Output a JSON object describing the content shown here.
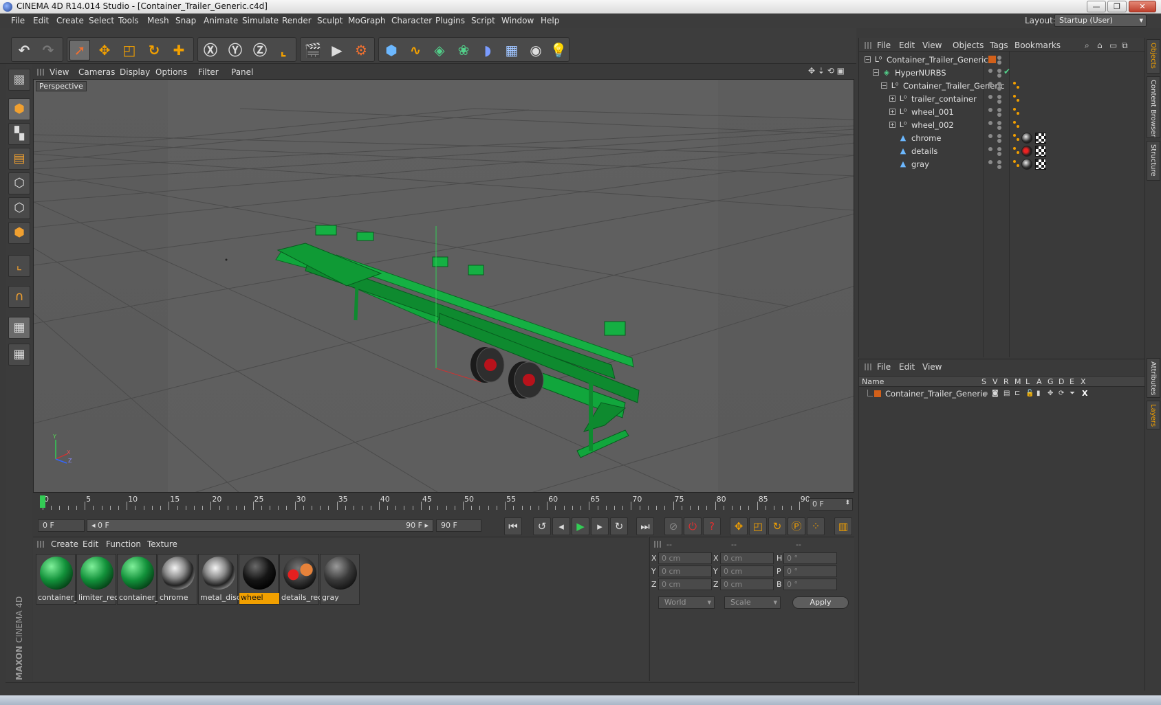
{
  "window": {
    "title": "CINEMA 4D R14.014 Studio - [Container_Trailer_Generic.c4d]",
    "buttons": {
      "minimize": "—",
      "maximize": "❐",
      "close": "✕"
    }
  },
  "menubar": {
    "items": [
      "File",
      "Edit",
      "Create",
      "Select",
      "Tools",
      "Mesh",
      "Snap",
      "Animate",
      "Simulate",
      "Render",
      "Sculpt",
      "MoGraph",
      "Character",
      "Plugins",
      "Script",
      "Window",
      "Help"
    ],
    "layout_label": "Layout:",
    "layout_value": "Startup (User)"
  },
  "viewport": {
    "menu": [
      "View",
      "Cameras",
      "Display",
      "Options",
      "Filter",
      "Panel"
    ],
    "label": "Perspective",
    "axis": {
      "y": "Y",
      "x": "X",
      "z": "Z"
    }
  },
  "timeline": {
    "ticks": [
      "0",
      "5",
      "10",
      "15",
      "20",
      "25",
      "30",
      "35",
      "40",
      "45",
      "50",
      "55",
      "60",
      "65",
      "70",
      "75",
      "80",
      "85",
      "90"
    ],
    "current_frame": "0 F",
    "end_display": "0 F"
  },
  "transport": {
    "start_field": "0 F",
    "range_start": "◂ 0 F",
    "range_end": "90 F ▸",
    "end_field": "90 F"
  },
  "materials": {
    "menu": [
      "Create",
      "Edit",
      "Function",
      "Texture"
    ],
    "items": [
      {
        "label": "container_f",
        "kind": "green"
      },
      {
        "label": "limiter_red",
        "kind": "green"
      },
      {
        "label": "container_t",
        "kind": "green"
      },
      {
        "label": "chrome",
        "kind": "chrome"
      },
      {
        "label": "metal_disc",
        "kind": "chrome"
      },
      {
        "label": "wheel",
        "kind": "black",
        "selected": true
      },
      {
        "label": "details_red",
        "kind": "red"
      },
      {
        "label": "gray",
        "kind": "gray"
      }
    ]
  },
  "coordinates": {
    "headers": [
      "--",
      "--",
      "--"
    ],
    "rows": [
      {
        "a": "X",
        "av": "0 cm",
        "b": "X",
        "bv": "0 cm",
        "c": "H",
        "cv": "0 °"
      },
      {
        "a": "Y",
        "av": "0 cm",
        "b": "Y",
        "bv": "0 cm",
        "c": "P",
        "cv": "0 °"
      },
      {
        "a": "Z",
        "av": "0 cm",
        "b": "Z",
        "bv": "0 cm",
        "c": "B",
        "cv": "0 °"
      }
    ],
    "mode1": "World",
    "mode2": "Scale",
    "apply": "Apply"
  },
  "objects": {
    "menu": [
      "File",
      "Edit",
      "View",
      "Objects",
      "Tags",
      "Bookmarks"
    ],
    "tree": [
      {
        "name": "Container_Trailer_Generic",
        "indent": 0,
        "icon": "null",
        "expander": "−"
      },
      {
        "name": "HyperNURBS",
        "indent": 1,
        "icon": "hypernurbs",
        "expander": "−"
      },
      {
        "name": "Container_Trailer_Generic",
        "indent": 2,
        "icon": "null",
        "expander": "−"
      },
      {
        "name": "trailer_container",
        "indent": 3,
        "icon": "null",
        "expander": "+"
      },
      {
        "name": "wheel_001",
        "indent": 3,
        "icon": "null",
        "expander": "+"
      },
      {
        "name": "wheel_002",
        "indent": 3,
        "icon": "null",
        "expander": "+"
      },
      {
        "name": "chrome",
        "indent": 3,
        "icon": "poly",
        "expander": ""
      },
      {
        "name": "details",
        "indent": 3,
        "icon": "poly",
        "expander": ""
      },
      {
        "name": "gray",
        "indent": 3,
        "icon": "poly",
        "expander": ""
      }
    ]
  },
  "layers": {
    "menu": [
      "File",
      "Edit",
      "View"
    ],
    "columns": [
      "Name",
      "S",
      "V",
      "R",
      "M",
      "L",
      "A",
      "G",
      "D",
      "E",
      "X"
    ],
    "rows": [
      {
        "name": "Container_Trailer_Generic"
      }
    ]
  },
  "right_tabs": [
    "Objects",
    "Content Browser",
    "Structure",
    "Attributes",
    "Layers"
  ],
  "brand": {
    "line1": "MAXON",
    "line2": "CINEMA 4D"
  },
  "colors": {
    "accent": "#f2a000",
    "model_green": "#0e8a2f",
    "panel": "#3a3a3a"
  }
}
